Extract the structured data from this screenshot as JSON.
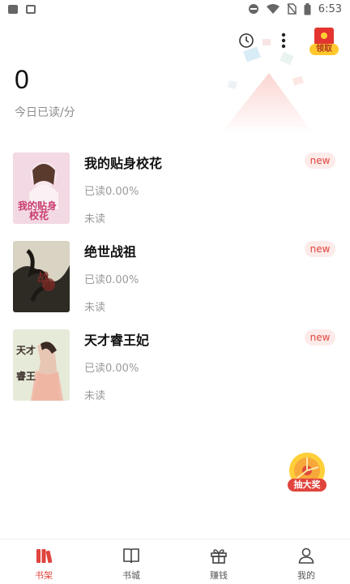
{
  "status_bar": {
    "time": "6:53"
  },
  "header": {
    "gift_label": "领取"
  },
  "today": {
    "count": "0",
    "label": "今日已读/分"
  },
  "books": [
    {
      "title": "我的贴身校花",
      "progress": "已读0.00%",
      "status": "未读",
      "badge": "new",
      "cover_color": "#f3d9e3"
    },
    {
      "title": "绝世战祖",
      "progress": "已读0.00%",
      "status": "未读",
      "badge": "new",
      "cover_color": "#2e2a24"
    },
    {
      "title": "天才睿王妃",
      "progress": "已读0.00%",
      "status": "未读",
      "badge": "new",
      "cover_color": "#e6ead9"
    }
  ],
  "lottery": {
    "label": "抽大奖"
  },
  "bottom_nav": [
    {
      "label": "书架",
      "icon": "bookshelf-icon",
      "active": true
    },
    {
      "label": "书城",
      "icon": "book-open-icon",
      "active": false
    },
    {
      "label": "赚钱",
      "icon": "gift-icon",
      "active": false
    },
    {
      "label": "我的",
      "icon": "person-icon",
      "active": false
    }
  ],
  "colors": {
    "accent": "#e0443d",
    "badge_bg": "#fdebea"
  }
}
